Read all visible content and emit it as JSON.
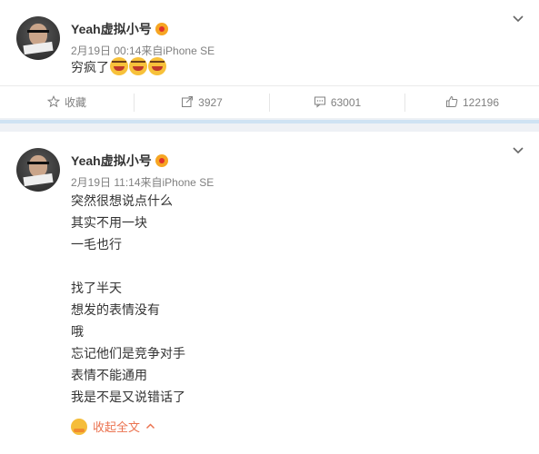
{
  "post1": {
    "username": "Yeah虚拟小号",
    "meta": "2月19日 00:14来自iPhone SE",
    "text": "穷疯了",
    "emojis": [
      "laugh-cry-icon",
      "laugh-cry-icon",
      "laugh-cry-icon"
    ],
    "toolbar": {
      "favorite_label": "收藏",
      "repost_count": "3927",
      "comment_count": "63001",
      "like_count": "122196"
    }
  },
  "post2": {
    "username": "Yeah虚拟小号",
    "meta": "2月19日 11:14来自iPhone SE",
    "lines": [
      "突然很想说点什么",
      "其实不用一块",
      "一毛也行",
      "",
      "找了半天",
      "想发的表情没有",
      "哦",
      "忘记他们是竞争对手",
      "表情不能通用",
      "我是不是又说错话了"
    ],
    "collapse_label": "收起全文"
  },
  "colors": {
    "link_orange": "#eb7350",
    "meta_gray": "#808080",
    "divider_blue": "#cfe3f3"
  }
}
